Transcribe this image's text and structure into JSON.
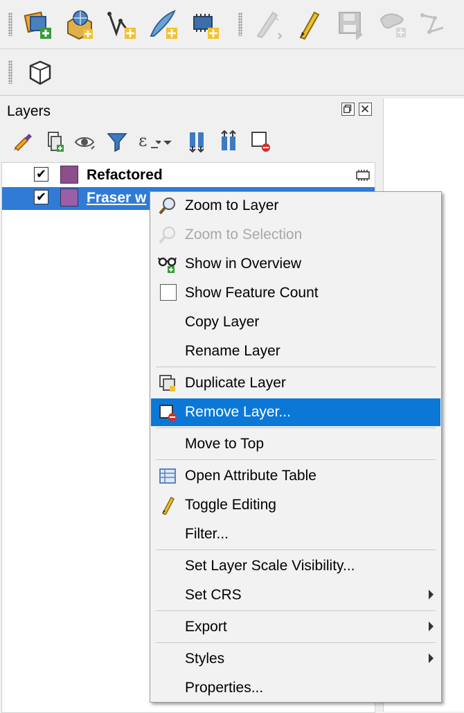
{
  "toolbar1": {
    "icons": [
      "new-project-icon",
      "open-data-source-manager-icon",
      "new-vector-layer-icon",
      "new-line-layer-icon",
      "new-virtual-layer-icon",
      "current-edits-icon",
      "toggle-editing-icon",
      "save-edits-icon",
      "digitize-icon",
      "vertex-tool-icon"
    ]
  },
  "toolbar2": {
    "icons": [
      "shape-icon"
    ]
  },
  "layers_panel": {
    "title": "Layers",
    "tools": [
      "style-manager-icon",
      "add-group-icon",
      "manage-visibility-icon",
      "filter-legend-icon",
      "filter-expression-icon",
      "expand-all-icon",
      "collapse-all-icon",
      "remove-layer-icon"
    ]
  },
  "layers": [
    {
      "name": "Refactored",
      "checked": "✔",
      "swatch_color": "#8b4f8c"
    },
    {
      "name": "Fraser w",
      "checked": "✔",
      "swatch_color": "#9a5fa6"
    }
  ],
  "context_menu": {
    "items": [
      {
        "label": "Zoom to Layer",
        "icon": "zoom-icon"
      },
      {
        "label": "Zoom to Selection",
        "icon": "zoom-selection-icon",
        "disabled": true
      },
      {
        "label": "Show in Overview",
        "icon": "overview-icon"
      },
      {
        "label": "Show Feature Count",
        "icon": "checkbox-icon"
      },
      {
        "label": "Copy Layer"
      },
      {
        "label": "Rename Layer"
      },
      {
        "label": "Duplicate Layer",
        "icon": "duplicate-icon"
      },
      {
        "label": "Remove Layer...",
        "icon": "remove-layer-icon",
        "selected": true
      },
      {
        "label": "Move to Top"
      },
      {
        "label": "Open Attribute Table",
        "icon": "table-icon"
      },
      {
        "label": "Toggle Editing",
        "icon": "pencil-icon"
      },
      {
        "label": "Filter..."
      },
      {
        "label": "Set Layer Scale Visibility..."
      },
      {
        "label": "Set CRS",
        "submenu": true
      },
      {
        "label": "Export",
        "submenu": true
      },
      {
        "label": "Styles",
        "submenu": true
      },
      {
        "label": "Properties..."
      }
    ]
  },
  "colors": {
    "selection": "#2f7bd6",
    "menu_highlight": "#0b78d7"
  }
}
